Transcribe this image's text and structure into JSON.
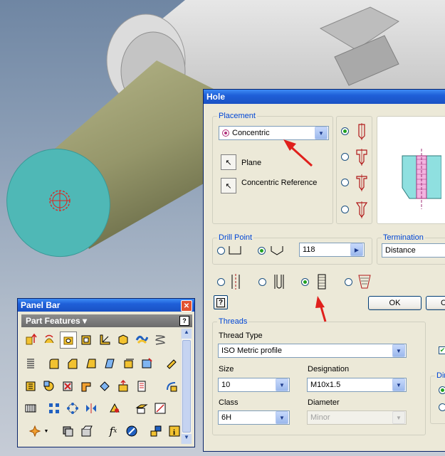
{
  "hole_dialog": {
    "title": "Hole",
    "placement": {
      "group_label": "Placement",
      "type_value": "Concentric",
      "plane_label": "Plane",
      "concentric_ref_label": "Concentric Reference"
    },
    "drill_point": {
      "group_label": "Drill Point",
      "angle_value": "118"
    },
    "termination": {
      "group_label": "Termination",
      "value": "Distance"
    },
    "ok_label": "OK",
    "cancel_label": "C",
    "threads": {
      "group_label": "Threads",
      "thread_type_label": "Thread Type",
      "thread_type_value": "ISO Metric profile",
      "size_label": "Size",
      "size_value": "10",
      "designation_label": "Designation",
      "designation_value": "M10x1.5",
      "class_label": "Class",
      "class_value": "6H",
      "diameter_label": "Diameter",
      "diameter_value": "Minor",
      "direction_label": "Dire"
    }
  },
  "panel_bar": {
    "title": "Panel Bar",
    "header_label": "Part Features ▾"
  },
  "colors": {
    "titlebar": "#1f5fd8",
    "dialog_bg": "#ece9d8",
    "group_label": "#0046d5",
    "cylinder_face": "#4fb8b6",
    "cylinder_side": "#9a9b6a",
    "arrow": "#e0201c"
  }
}
